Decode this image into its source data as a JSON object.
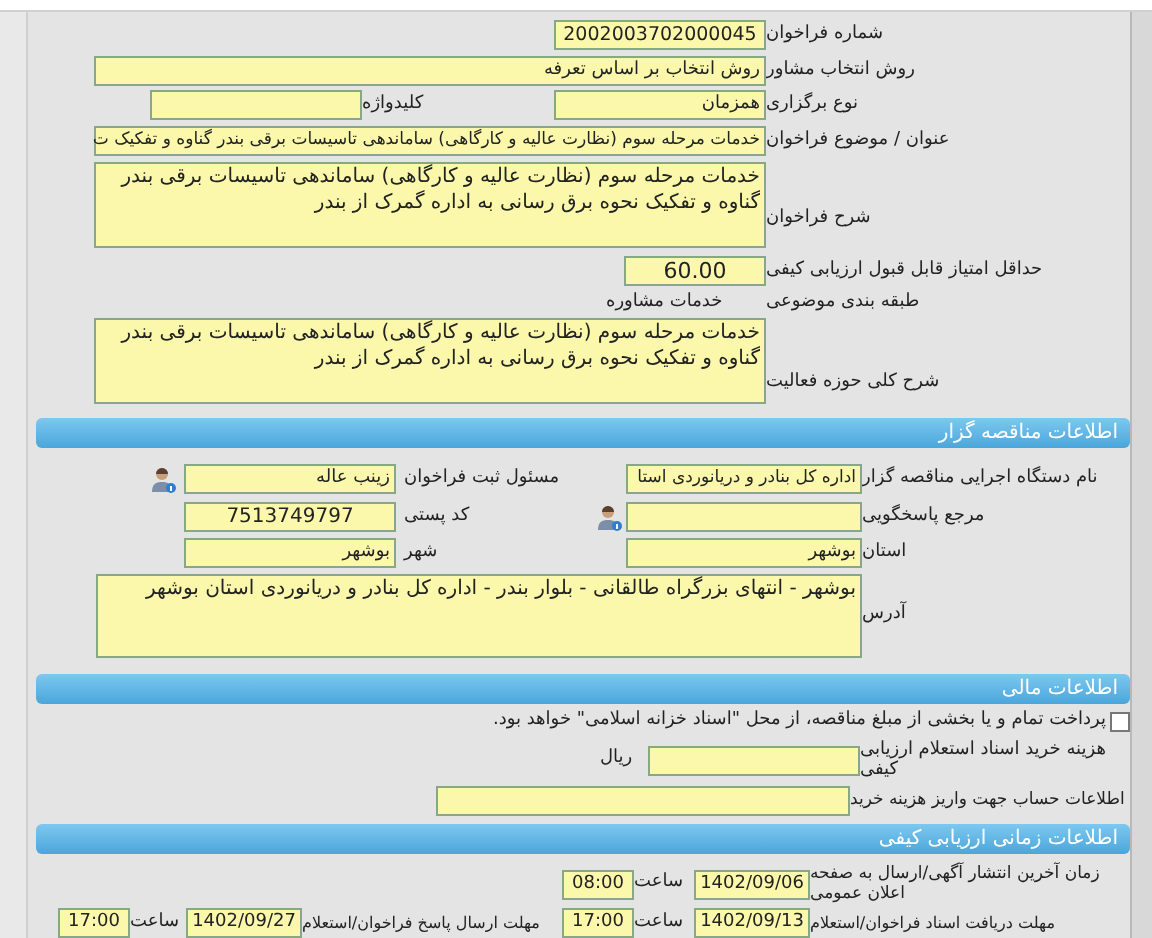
{
  "form": {
    "call_number": {
      "label": "شماره فراخوان",
      "value": "2002003702000045"
    },
    "selection_method": {
      "label": "روش انتخاب مشاور",
      "value": "روش انتخاب بر اساس تعرفه"
    },
    "holding_type": {
      "label": "نوع برگزاری",
      "value": "همزمان"
    },
    "keyword": {
      "label": "کلیدواژه"
    },
    "subject": {
      "label": "عنوان / موضوع فراخوان",
      "value": "خدمات مرحله سوم (نظارت عالیه و کارگاهی) ساماندهی تاسیسات برقی بندر گناوه و تفکیک ت"
    },
    "description": {
      "label": "شرح فراخوان",
      "value": "خدمات مرحله سوم (نظارت عالیه و کارگاهی) ساماندهی تاسیسات برقی بندر گناوه و تفکیک نحوه برق رسانی به اداره گمرک از بندر"
    },
    "min_score": {
      "label": "حداقل امتیاز قابل قبول ارزیابی کیفی",
      "value": "60.00"
    },
    "category": {
      "label": "طبقه بندی موضوعی",
      "value": "خدمات مشاوره"
    },
    "activity_scope": {
      "label": "شرح کلی حوزه فعالیت",
      "value": "خدمات مرحله سوم (نظارت عالیه و کارگاهی) ساماندهی تاسیسات برقی بندر گناوه و تفکیک نحوه برق رسانی به اداره گمرک از بندر"
    }
  },
  "tenderer": {
    "title": "اطلاعات مناقصه گزار",
    "agency": {
      "label": "نام دستگاه اجرایی مناقصه گزار",
      "value": "اداره کل بنادر و دریانوردی استا"
    },
    "registrar": {
      "label": "مسئول ثبت فراخوان",
      "value": "زینب عاله"
    },
    "responder": {
      "label": "مرجع پاسخگویی"
    },
    "postal_code": {
      "label": "کد پستی",
      "value": "7513749797"
    },
    "province": {
      "label": "استان",
      "value": "بوشهر"
    },
    "city": {
      "label": "شهر",
      "value": "بوشهر"
    },
    "address": {
      "label": "آدرس",
      "value": "بوشهر - انتهای بزرگراه طالقانی - بلوار بندر - اداره کل بنادر و دریانوردی استان بوشهر"
    }
  },
  "finance": {
    "title": "اطلاعات مالی",
    "treasury_payment": {
      "text": "پرداخت تمام و یا بخشی از مبلغ مناقصه، از محل \"اسناد خزانه اسلامی\" خواهد بود.",
      "checked": false
    },
    "document_fee": {
      "label": "هزینه خرید اسناد استعلام ارزیابی کیفی",
      "unit": "ریال"
    },
    "account_info": {
      "label": "اطلاعات حساب جهت واریز هزینه خرید"
    }
  },
  "schedule": {
    "title": "اطلاعات زمانی ارزیابی کیفی",
    "publish": {
      "label": "زمان آخرین انتشار آگهی/ارسال به صفحه اعلان عمومی",
      "date": "1402/09/06",
      "time_label": "ساعت",
      "time": "08:00"
    },
    "receive_deadline": {
      "label": "مهلت دریافت اسناد فراخوان/استعلام",
      "date": "1402/09/13",
      "time_label": "ساعت",
      "time": "17:00"
    },
    "reply_deadline": {
      "label": "مهلت ارسال پاسخ فراخوان/استعلام",
      "date": "1402/09/27",
      "time_label": "ساعت",
      "time": "17:00"
    }
  }
}
